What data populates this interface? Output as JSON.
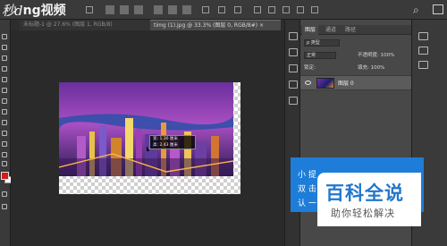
{
  "app": {
    "logo_mark": "秒d",
    "logo_mark2": "ng视频"
  },
  "tabs": [
    {
      "label": "未标题-1 @ 27.6% (图层 1, RGB/8)",
      "active": false
    },
    {
      "label": "timg (1).jpg @ 33.3% (图层 0, RGB/8#) ×",
      "active": true
    }
  ],
  "tooltip": {
    "line1": "宽: 1.30 厘米",
    "line2": "高: 2.43 厘米"
  },
  "layers_panel": {
    "tabs": [
      "图层",
      "通道",
      "路径"
    ],
    "filter_label": "ρ 类型",
    "blend_mode": "正常",
    "opacity_label": "不透明度: 100%",
    "lock_label": "锁定:",
    "fill_label": "填充: 100%",
    "layer_name": "图层 0"
  },
  "notice": {
    "lines": [
      "小 提",
      "双 击",
      "认 一"
    ]
  },
  "watermark": {
    "title": "百科全说",
    "subtitle": "助你轻松解决"
  },
  "colors": {
    "foreground": "#d01c1c",
    "background": "#ffffff",
    "accent": "#1d7dd8"
  }
}
